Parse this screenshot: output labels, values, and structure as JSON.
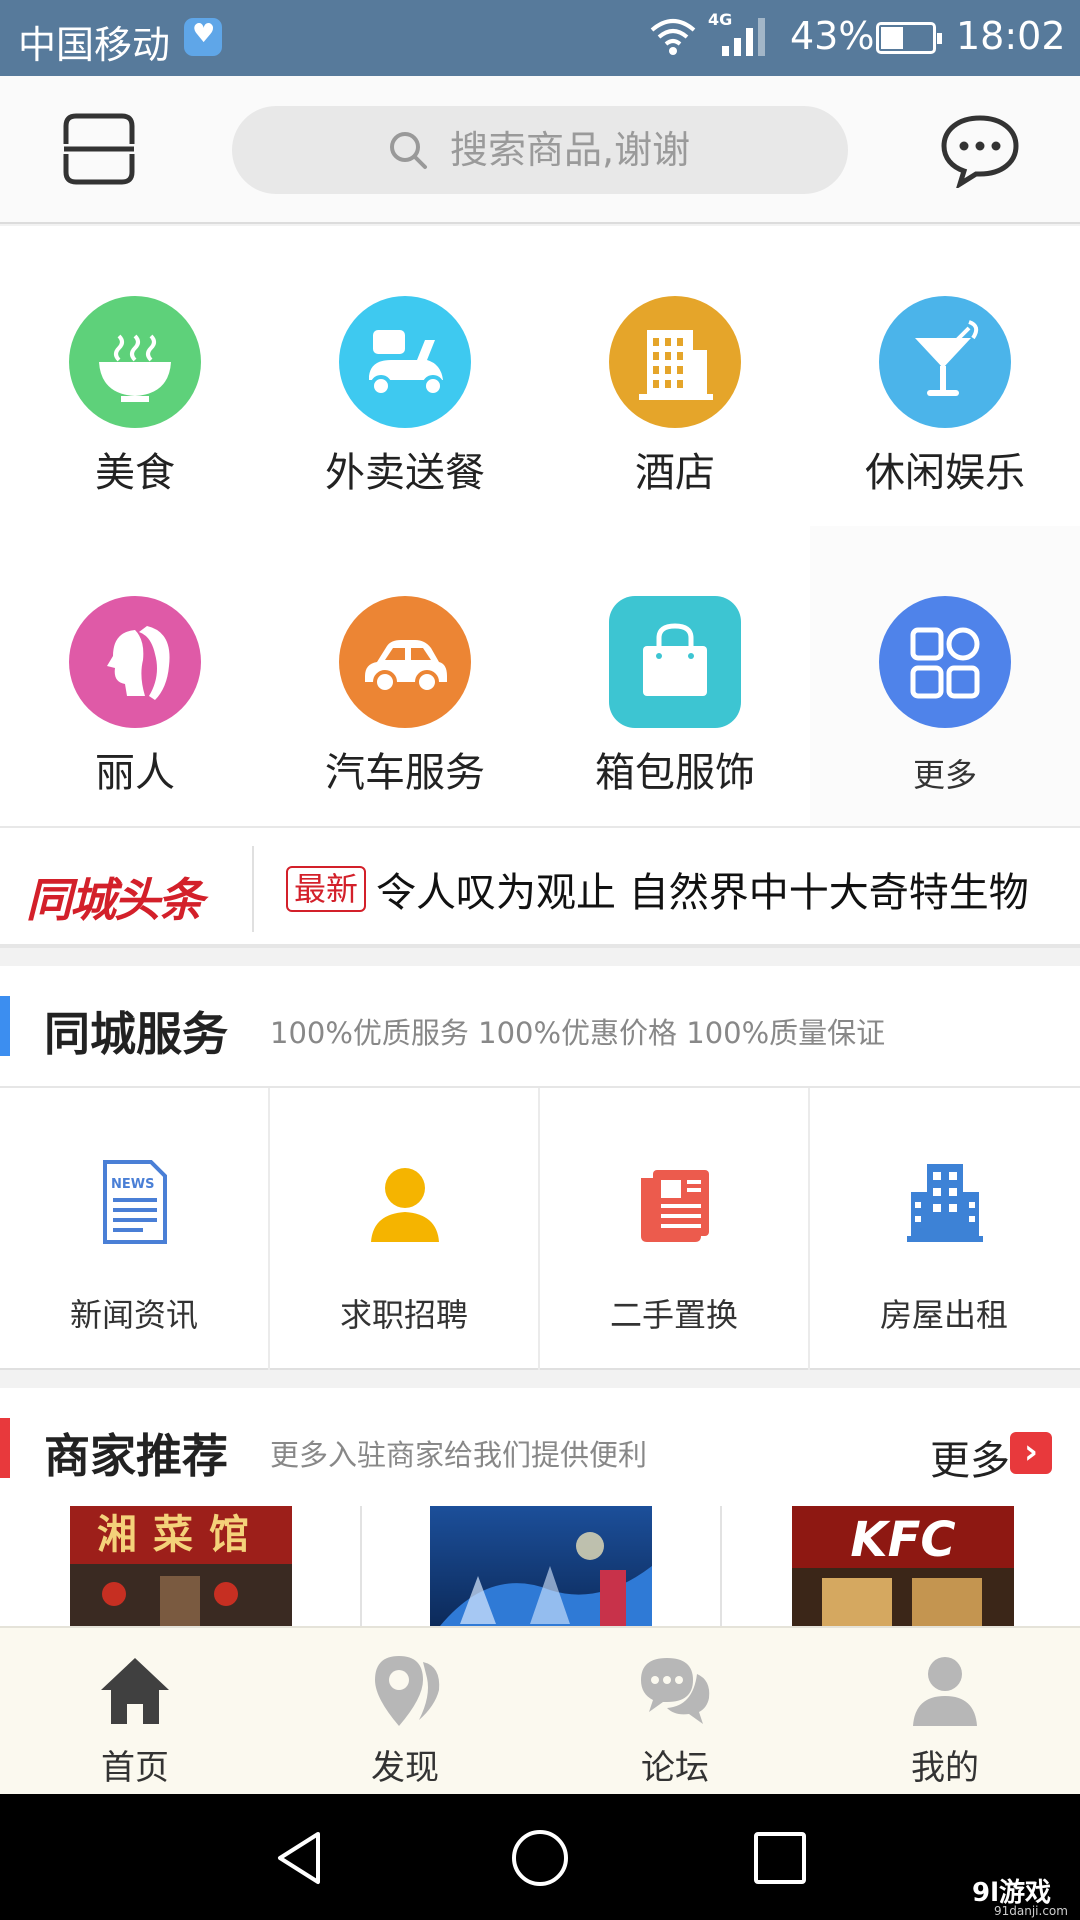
{
  "status_bar": {
    "carrier": "中国移动",
    "network": "4G",
    "battery": "43%",
    "time": "18:02"
  },
  "header": {
    "search_placeholder": "搜索商品,谢谢"
  },
  "categories": [
    {
      "label": "美食",
      "icon": "food-bowl-icon",
      "color": "#5ed17a"
    },
    {
      "label": "外卖送餐",
      "icon": "delivery-scooter-icon",
      "color": "#3ec9f0"
    },
    {
      "label": "酒店",
      "icon": "hotel-building-icon",
      "color": "#e5a52a"
    },
    {
      "label": "休闲娱乐",
      "icon": "cocktail-icon",
      "color": "#4bb4ea"
    },
    {
      "label": "丽人",
      "icon": "beauty-woman-icon",
      "color": "#df5aa7"
    },
    {
      "label": "汽车服务",
      "icon": "car-icon",
      "color": "#ec8534"
    },
    {
      "label": "箱包服饰",
      "icon": "shopping-bag-icon",
      "color": "#3dc5d2"
    },
    {
      "label": "更多",
      "icon": "more-grid-icon",
      "color": "#4f83ea"
    }
  ],
  "headline": {
    "brand": "同城头条",
    "badge": "最新",
    "text": "令人叹为观止 自然界中十大奇特生物"
  },
  "city_services": {
    "title": "同城服务",
    "subtitle": "100%优质服务 100%优惠价格 100%质量保证",
    "accent": "#3c8ef0",
    "items": [
      {
        "label": "新闻资讯",
        "icon": "news-icon"
      },
      {
        "label": "求职招聘",
        "icon": "person-icon"
      },
      {
        "label": "二手置换",
        "icon": "newspaper-icon"
      },
      {
        "label": "房屋出租",
        "icon": "building-icon"
      }
    ]
  },
  "merchants": {
    "title": "商家推荐",
    "subtitle": "更多入驻商家给我们提供便利",
    "more": "更多",
    "accent": "#e8393c",
    "items": [
      {
        "caption": "湘菜馆"
      },
      {
        "caption": ""
      },
      {
        "caption": "KFC"
      }
    ]
  },
  "tabs": [
    {
      "label": "首页",
      "icon": "home-icon",
      "active": true
    },
    {
      "label": "发现",
      "icon": "location-icon",
      "active": false
    },
    {
      "label": "论坛",
      "icon": "chat-bubbles-icon",
      "active": false
    },
    {
      "label": "我的",
      "icon": "user-icon",
      "active": false
    }
  ],
  "watermark": {
    "logo": "9l游戏",
    "site": "91danji.com"
  }
}
